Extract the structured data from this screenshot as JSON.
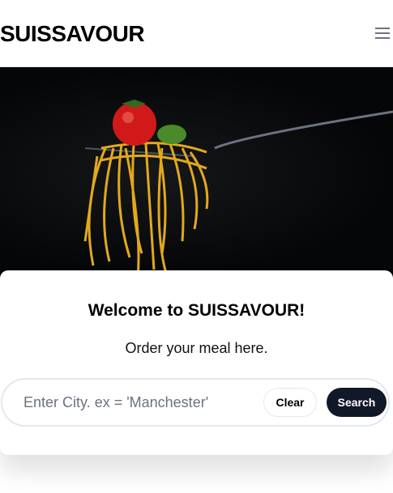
{
  "header": {
    "logo": "SUISSAVOUR",
    "menu_icon": "hamburger-icon"
  },
  "hero": {
    "image": "spaghetti-on-fork-with-tomato"
  },
  "card": {
    "title": "Welcome to SUISSAVOUR!",
    "subtitle": "Order your meal here."
  },
  "search": {
    "placeholder": "Enter City. ex = 'Manchester'",
    "value": "",
    "clear_label": "Clear",
    "search_label": "Search"
  },
  "colors": {
    "search_button": "#111827"
  }
}
